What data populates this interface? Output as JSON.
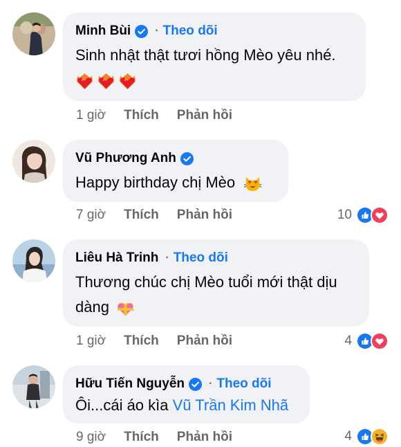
{
  "comments": [
    {
      "author": "Minh Bùi",
      "verified": true,
      "follow_label": "Theo dõi",
      "text": "Sinh nhật thật tươi hồng Mèo yêu nhé.",
      "emojis": [
        "burning-heart",
        "burning-heart",
        "burning-heart"
      ],
      "time": "1 giờ",
      "like_label": "Thích",
      "reply_label": "Phản hồi",
      "reaction_count": "",
      "reactions": []
    },
    {
      "author": "Vũ Phương Anh",
      "verified": true,
      "follow_label": "",
      "text": "Happy birthday chị Mèo",
      "emojis": [
        "heart-eyes-cat"
      ],
      "time": "7 giờ",
      "like_label": "Thích",
      "reply_label": "Phản hồi",
      "reaction_count": "10",
      "reactions": [
        "like",
        "love"
      ]
    },
    {
      "author": "Liêu Hà Trinh",
      "verified": false,
      "follow_label": "Theo dõi",
      "text_line1": "Thương chúc chị Mèo tuổi mới thật dịu",
      "text_line2": "dàng",
      "emojis": [
        "heart-with-ribbon"
      ],
      "time": "1 giờ",
      "like_label": "Thích",
      "reply_label": "Phản hồi",
      "reaction_count": "4",
      "reactions": [
        "like",
        "love"
      ]
    },
    {
      "author": "Hữu Tiến Nguyễn",
      "verified": true,
      "follow_label": "Theo dõi",
      "text": "Ôi...cái áo kìa",
      "mention": "Vũ Trần Kim Nhã",
      "time": "9 giờ",
      "like_label": "Thích",
      "reply_label": "Phản hồi",
      "reaction_count": "4",
      "reactions": [
        "like",
        "haha"
      ]
    }
  ],
  "colors": {
    "bubble": "#f0f2f5",
    "link": "#1877f2",
    "secondary_text": "#65676b",
    "love": "#f33e58"
  }
}
